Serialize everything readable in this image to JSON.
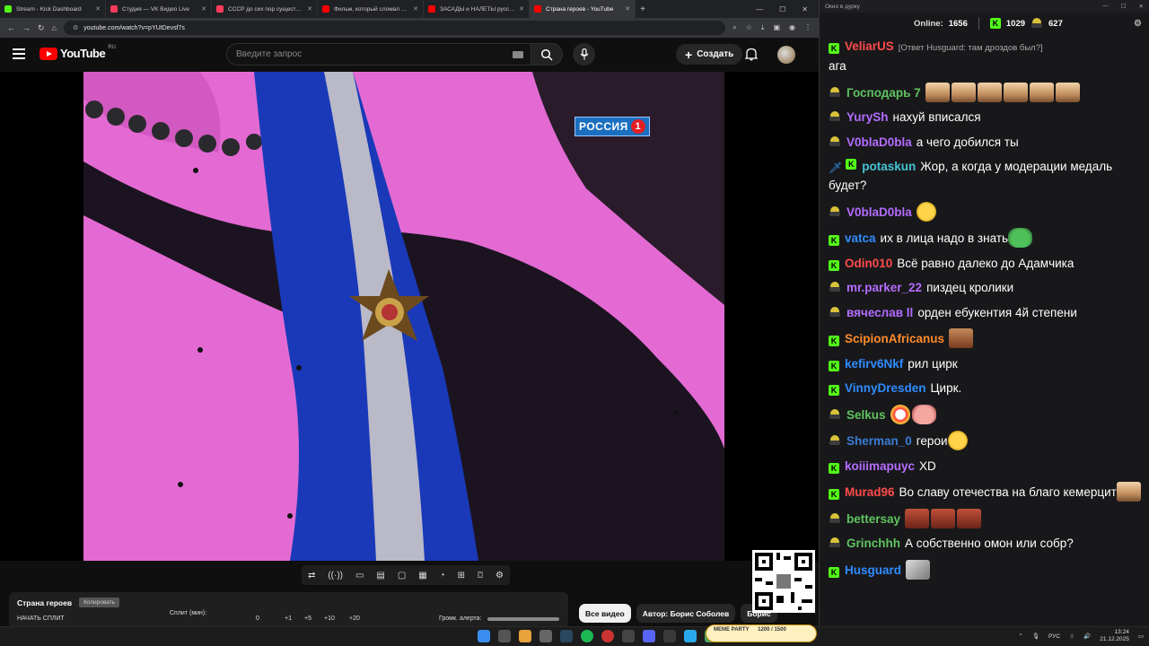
{
  "browser": {
    "tabs": [
      {
        "title": "Stream - Kick Dashboard",
        "color": "#53fc18"
      },
      {
        "title": "Студия — VK Видео Live",
        "color": "#ff3b5c"
      },
      {
        "title": "СССР до сих пор существует: А",
        "color": "#ff3b5c"
      },
      {
        "title": "Фильм, который сломал Тома",
        "color": "#ff0000"
      },
      {
        "title": "ЗАСАДЫ и НАЛЁТЫ русских Р",
        "color": "#ff0000"
      },
      {
        "title": "Страна героев - YouTube",
        "color": "#ff0000"
      }
    ],
    "url": "youtube.com/watch?v=pYUtDevsf7s"
  },
  "youtube": {
    "logo_text": "YouTube",
    "region": "RU",
    "search_placeholder": "Введите запрос",
    "create_label": "Создать"
  },
  "video": {
    "channel_logo_text": "РОССИЯ",
    "channel_logo_num": "1"
  },
  "player_panel": {
    "title": "Страна героев",
    "copy_label": "Копировать",
    "split_start": "НАЧАТЬ СПЛИТ",
    "split_min": "Сплит (мин):",
    "split_values": [
      "0",
      "+1",
      "+5",
      "+10",
      "+20"
    ],
    "alert_volume": "Громк. алерта:"
  },
  "chips": [
    "Все видео",
    "Автор: Борис Соболев",
    "Борис"
  ],
  "chat": {
    "window_title": "Окно в дурку",
    "online_label": "Online:",
    "online_count": "1656",
    "kick_count": "1029",
    "party_count": "627",
    "messages": [
      {
        "user": "VeliarUS",
        "color": "#ff4b4b",
        "badges": [
          "k"
        ],
        "reply": "[Ответ Husguard: там дроздов был?]",
        "text": "ага",
        "emotes": []
      },
      {
        "user": "Господарь 7",
        "color": "#5fc35f",
        "badges": [
          "p"
        ],
        "text": "",
        "emotes": [
          "face",
          "face",
          "face",
          "face",
          "face",
          "face"
        ]
      },
      {
        "user": "YurySh",
        "color": "#b46cff",
        "badges": [
          "p"
        ],
        "text": "нахуй вписался",
        "emotes": []
      },
      {
        "user": "V0blaD0bla",
        "color": "#b46cff",
        "badges": [
          "p"
        ],
        "text": "а чего добился ты",
        "emotes": []
      },
      {
        "user": "potaskun",
        "color": "#45c4d6",
        "badges": [
          "sword",
          "k"
        ],
        "text": "Жор, а когда у модерации медаль будет?",
        "emotes": []
      },
      {
        "user": "V0blaD0bla",
        "color": "#b46cff",
        "badges": [
          "p"
        ],
        "text": "",
        "emotes": [
          "yellow"
        ]
      },
      {
        "user": "vatca",
        "color": "#2f8cff",
        "badges": [
          "k"
        ],
        "text": "их в лица надо в знать",
        "emotes": [
          "frog"
        ]
      },
      {
        "user": "Odin010",
        "color": "#ff4b4b",
        "badges": [
          "k"
        ],
        "text": "Всё равно далеко до Адамчика",
        "emotes": []
      },
      {
        "user": "mr.parker_22",
        "color": "#b46cff",
        "badges": [
          "p"
        ],
        "text": "пиздец кролики",
        "emotes": []
      },
      {
        "user": "вячеслав ll",
        "color": "#b46cff",
        "badges": [
          "p"
        ],
        "text": "орден ебукентия 4й степени",
        "emotes": []
      },
      {
        "user": "ScipionAfricanus",
        "color": "#ff8a2a",
        "badges": [
          "k"
        ],
        "text": "",
        "emotes": [
          "mustache"
        ]
      },
      {
        "user": "kefirv6Nkf",
        "color": "#2f8cff",
        "badges": [
          "k"
        ],
        "text": "рил цирк",
        "emotes": []
      },
      {
        "user": "VinnyDresden",
        "color": "#2f8cff",
        "badges": [
          "k"
        ],
        "text": "Цирк.",
        "emotes": []
      },
      {
        "user": "Selkus",
        "color": "#5fc35f",
        "badges": [
          "p"
        ],
        "text": "",
        "emotes": [
          "clown",
          "pig"
        ]
      },
      {
        "user": "Sherman_0",
        "color": "#3a7bd5",
        "badges": [
          "p"
        ],
        "text": "герои",
        "emotes": [
          "yellow"
        ]
      },
      {
        "user": "koiiimapuyc",
        "color": "#b46cff",
        "badges": [
          "k"
        ],
        "text": "XD",
        "emotes": []
      },
      {
        "user": "Murad96",
        "color": "#ff4b4b",
        "badges": [
          "k"
        ],
        "text": "Во славу отечества на благо кемерцит",
        "emotes": [
          "face"
        ]
      },
      {
        "user": "bettersay",
        "color": "#5fc35f",
        "badges": [
          "p"
        ],
        "text": "",
        "emotes": [
          "red",
          "red",
          "red"
        ]
      },
      {
        "user": "Grinchhh",
        "color": "#5fc35f",
        "badges": [
          "p"
        ],
        "text": "А собственно омон или собр?",
        "emotes": []
      },
      {
        "user": "Husguard",
        "color": "#2f8cff",
        "badges": [
          "k"
        ],
        "text": "",
        "emotes": [
          "card"
        ]
      }
    ]
  },
  "taskbar": {
    "lang": "РУС",
    "time": "13:24",
    "date": "21.12.2025",
    "meme_party": "MEME PARTY",
    "meme_party_count": "1200 / 1500"
  }
}
